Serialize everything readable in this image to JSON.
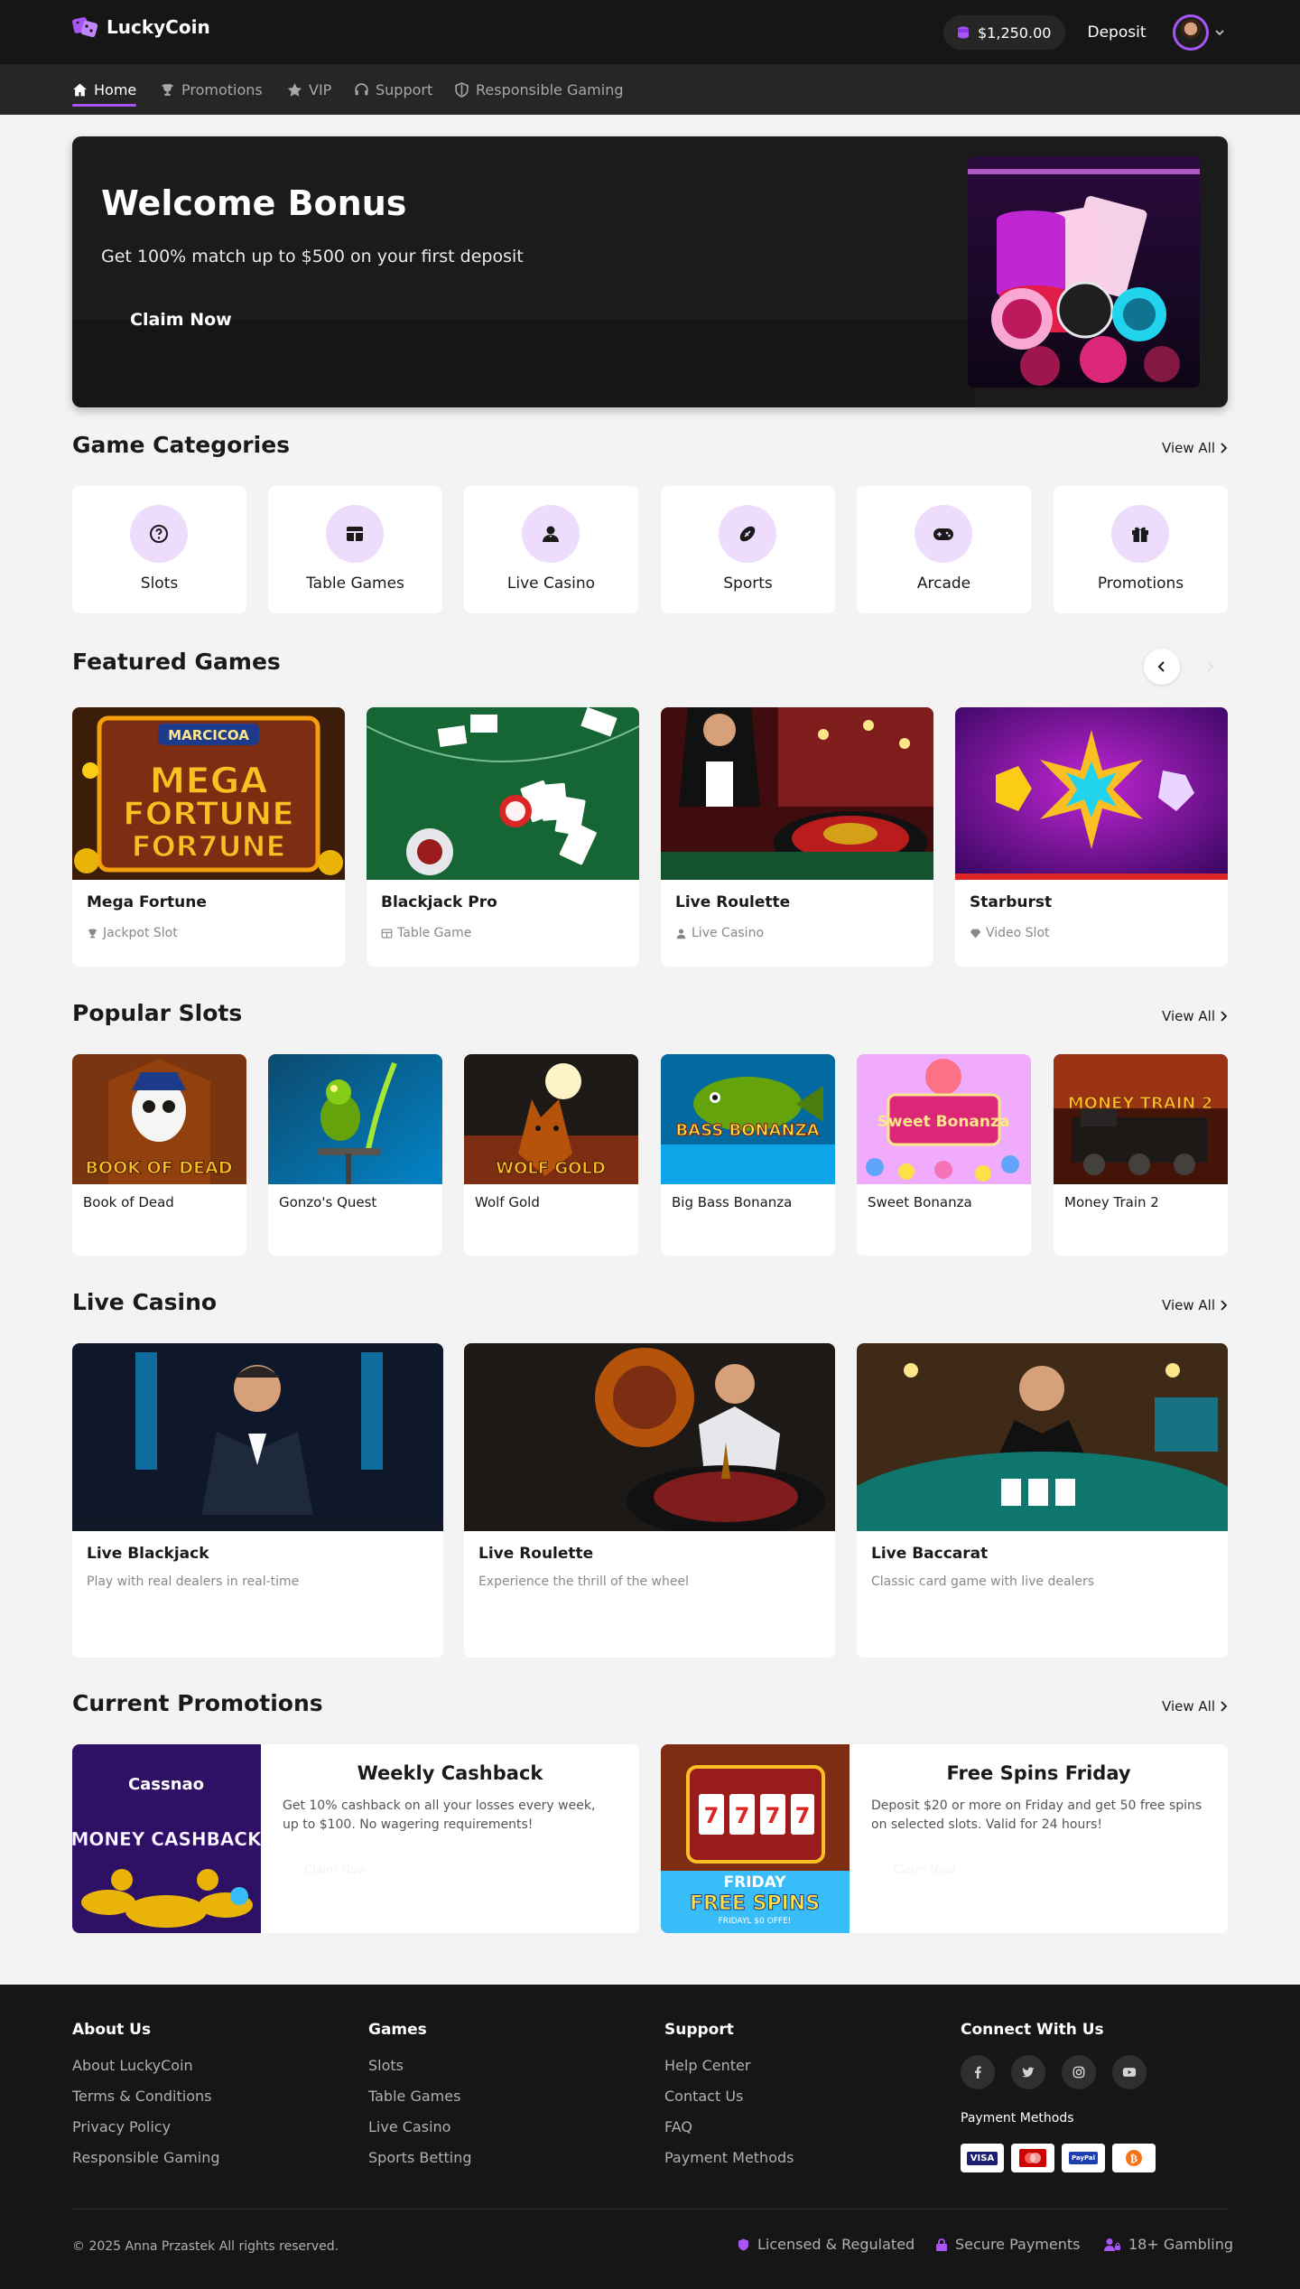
{
  "brand": {
    "name": "LuckyCoin",
    "accent": "#a855f7"
  },
  "header": {
    "balance": "$1,250.00",
    "deposit_label": "Deposit"
  },
  "nav": {
    "items": [
      {
        "label": "Home",
        "icon": "home-icon"
      },
      {
        "label": "Promotions",
        "icon": "trophy-icon"
      },
      {
        "label": "VIP",
        "icon": "star-icon"
      },
      {
        "label": "Support",
        "icon": "headset-icon"
      },
      {
        "label": "Responsible Gaming",
        "icon": "shield-icon"
      }
    ]
  },
  "hero": {
    "title": "Welcome Bonus",
    "subtitle": "Get 100% match up to $500 on your first deposit",
    "cta": "Claim Now"
  },
  "categories": {
    "title": "Game Categories",
    "view_all": "View All",
    "items": [
      {
        "label": "Slots",
        "icon": "question-icon"
      },
      {
        "label": "Table Games",
        "icon": "table-icon"
      },
      {
        "label": "Live Casino",
        "icon": "dealer-icon"
      },
      {
        "label": "Sports",
        "icon": "football-icon"
      },
      {
        "label": "Arcade",
        "icon": "gamepad-icon"
      },
      {
        "label": "Promotions",
        "icon": "gift-icon"
      }
    ]
  },
  "featured": {
    "title": "Featured Games",
    "games": [
      {
        "name": "Mega Fortune",
        "meta": "Jackpot Slot",
        "icon": "trophy-icon",
        "img_text": "MARCICOA"
      },
      {
        "name": "Blackjack Pro",
        "meta": "Table Game",
        "icon": "table-icon"
      },
      {
        "name": "Live Roulette",
        "meta": "Live Casino",
        "icon": "user-icon"
      },
      {
        "name": "Starburst",
        "meta": "Video Slot",
        "icon": "gem-icon"
      }
    ]
  },
  "popular_slots": {
    "title": "Popular Slots",
    "view_all": "View All",
    "items": [
      {
        "name": "Book of Dead",
        "img_text": "BOOK OF DEAD"
      },
      {
        "name": "Gonzo's Quest"
      },
      {
        "name": "Wolf Gold",
        "img_text": "WOLF GOLD"
      },
      {
        "name": "Big Bass Bonanza",
        "img_text": "BASS BONANZA"
      },
      {
        "name": "Sweet Bonanza",
        "img_text": "Sweet Bonanza"
      },
      {
        "name": "Money Train 2",
        "img_text": "MONEY TRAIN 2"
      }
    ]
  },
  "live_casino": {
    "title": "Live Casino",
    "view_all": "View All",
    "items": [
      {
        "name": "Live Blackjack",
        "desc": "Play with real dealers in real-time"
      },
      {
        "name": "Live Roulette",
        "desc": "Experience the thrill of the wheel"
      },
      {
        "name": "Live Baccarat",
        "desc": "Classic card game with live dealers"
      }
    ]
  },
  "promotions": {
    "title": "Current Promotions",
    "view_all": "View All",
    "items": [
      {
        "title": "Weekly Cashback",
        "desc": "Get 10% cashback on all your losses every week, up to $100. No wagering requirements!",
        "btn": "Claim Now",
        "img_top": "Cassnao",
        "img_main": "MONEY CASHBACK"
      },
      {
        "title": "Free Spins Friday",
        "desc": "Deposit $20 or more on Friday and get 50 free spins on selected slots. Valid for 24 hours!",
        "btn": "Claim Now",
        "img_top": "FRIDAY",
        "img_main": "FREE SPINS",
        "img_sub": "FRIDAYL $0 OFFE!"
      }
    ]
  },
  "footer": {
    "about": {
      "title": "About Us",
      "links": [
        "About LuckyCoin",
        "Terms & Conditions",
        "Privacy Policy",
        "Responsible Gaming"
      ]
    },
    "games": {
      "title": "Games",
      "links": [
        "Slots",
        "Table Games",
        "Live Casino",
        "Sports Betting"
      ]
    },
    "support": {
      "title": "Support",
      "links": [
        "Help Center",
        "Contact Us",
        "FAQ",
        "Payment Methods"
      ]
    },
    "connect": {
      "title": "Connect With Us",
      "socials": [
        "facebook-icon",
        "twitter-icon",
        "instagram-icon",
        "youtube-icon"
      ]
    },
    "payment_title": "Payment Methods",
    "payments": [
      "VISA",
      "mastercard",
      "PayPal",
      "bitcoin"
    ],
    "copyright": "© 2025 Anna Przastek All rights reserved.",
    "badges": [
      "Licensed & Regulated",
      "Secure Payments",
      "18+ Gambling"
    ]
  }
}
